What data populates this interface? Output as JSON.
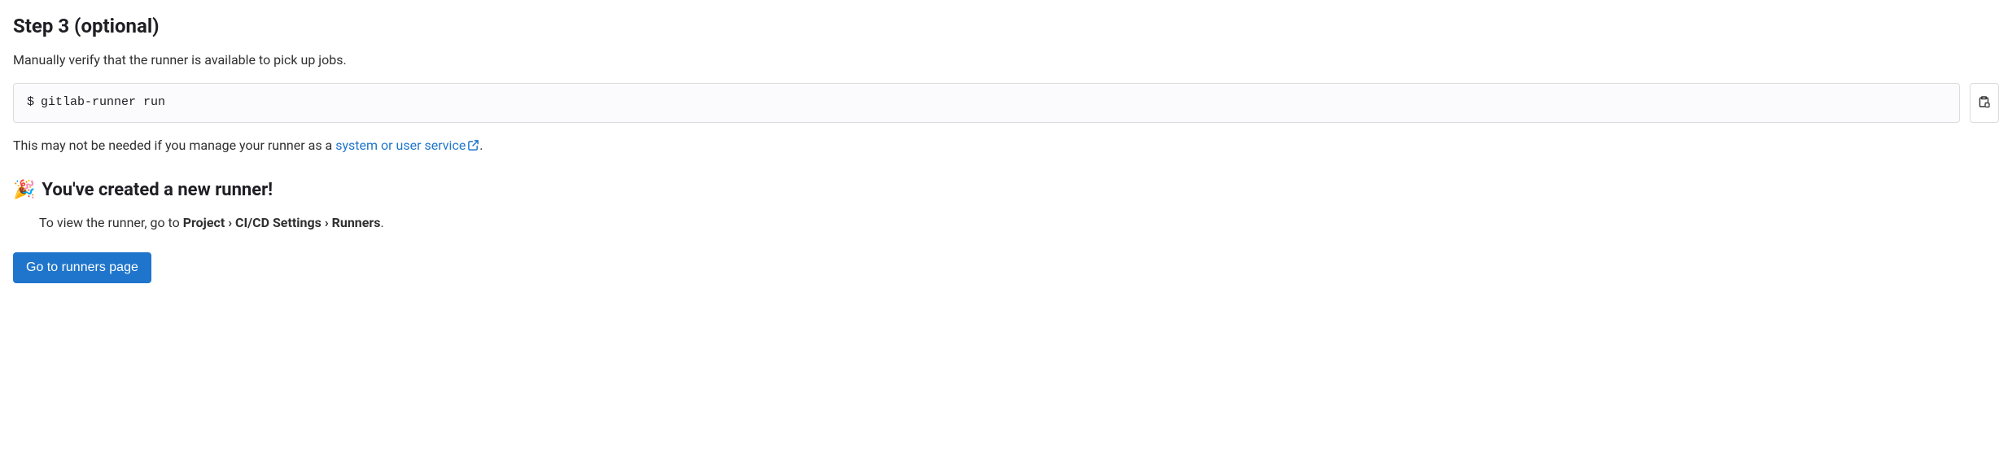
{
  "step": {
    "heading": "Step 3 (optional)",
    "description": "Manually verify that the runner is available to pick up jobs."
  },
  "code": {
    "prompt": "$",
    "command": "gitlab-runner run"
  },
  "note": {
    "prefix": "This may not be needed if you manage your runner as a ",
    "link_text": "system or user service",
    "suffix": "."
  },
  "success": {
    "emoji": "🎉",
    "heading": "You've created a new runner!",
    "desc_prefix": "To view the runner, go to ",
    "desc_bold": "Project › CI/CD Settings › Runners",
    "desc_suffix": "."
  },
  "button": {
    "label": "Go to runners page"
  }
}
